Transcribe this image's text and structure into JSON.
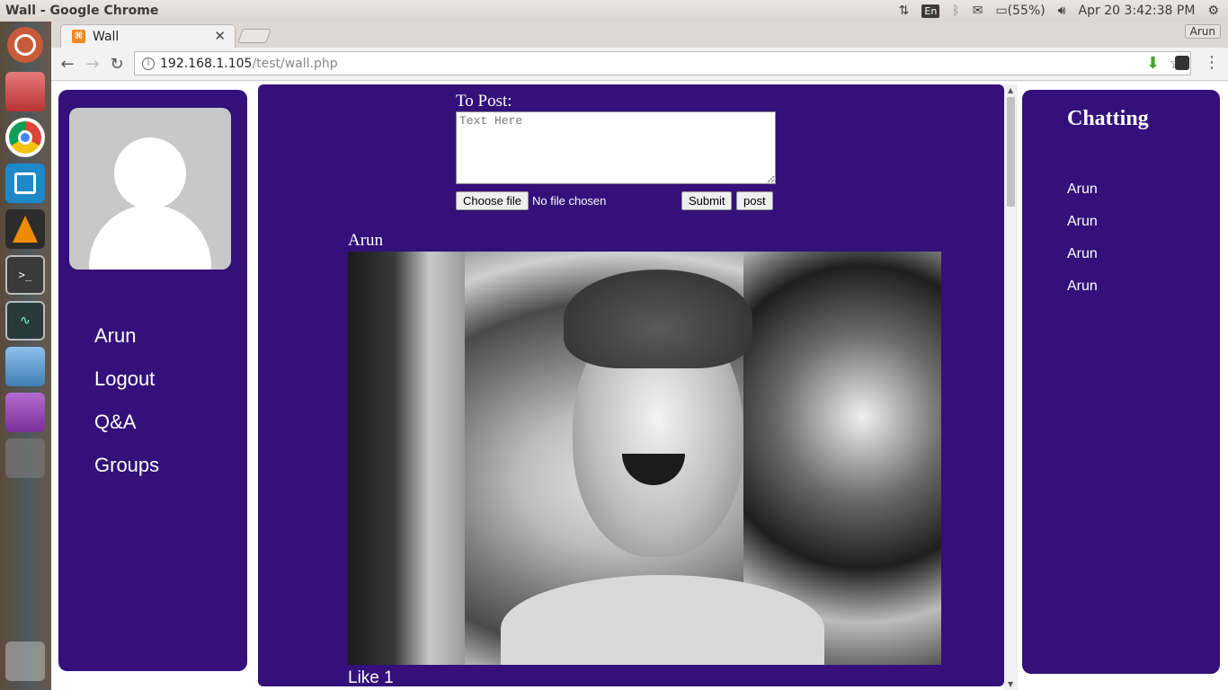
{
  "os": {
    "window_title": "Wall - Google Chrome",
    "keyboard_layout": "En",
    "battery": "(55%)",
    "datetime": "Apr 20  3:42:38 PM"
  },
  "browser": {
    "tab_title": "Wall",
    "profile_name": "Arun",
    "url_host": "192.168.1.105",
    "url_path": "/test/wall.php"
  },
  "page": {
    "sidebar": {
      "items": [
        {
          "label": "Arun"
        },
        {
          "label": "Logout"
        },
        {
          "label": "Q&A"
        },
        {
          "label": "Groups"
        }
      ]
    },
    "composer": {
      "label": "To Post:",
      "placeholder": "Text Here",
      "file_button": "Choose file",
      "file_status": "No file chosen",
      "submit_label": "Submit",
      "post_label": "post"
    },
    "feed": {
      "author": "Arun",
      "like_text": "Like 1"
    },
    "chat": {
      "title": "Chatting",
      "users": [
        "Arun",
        "Arun",
        "Arun",
        "Arun"
      ]
    }
  },
  "colors": {
    "panel_bg": "#33107a",
    "page_bg": "#ffffff"
  }
}
